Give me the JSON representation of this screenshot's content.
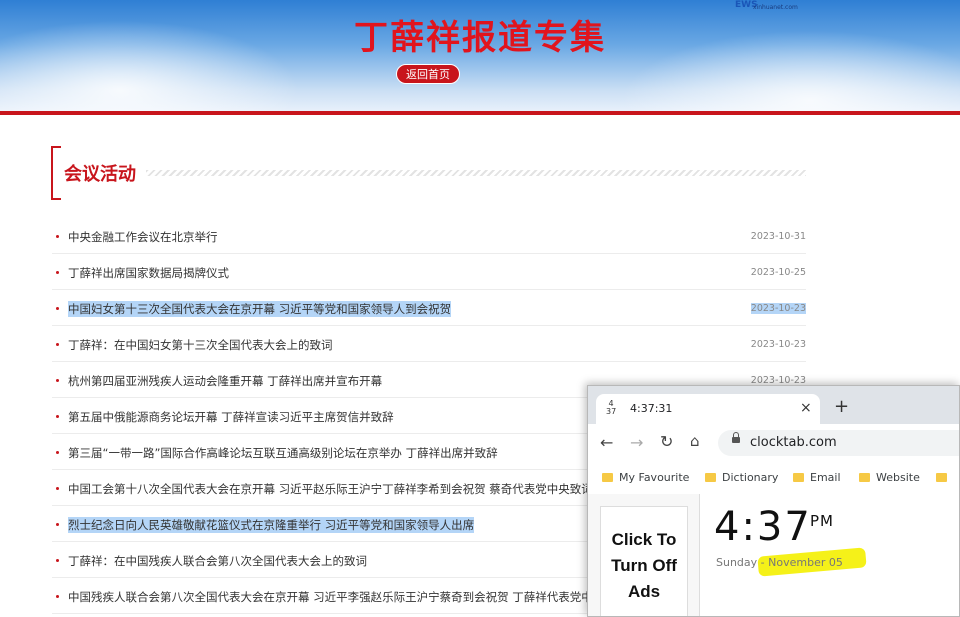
{
  "header": {
    "title": "丁薛祥报道专集",
    "home_label": "返回首页",
    "logo_mark": "EWS",
    "logo_url": "xinhuanet.com"
  },
  "section": {
    "title": "会议活动"
  },
  "news": [
    {
      "title": "中央金融工作会议在北京举行",
      "date": "2023-10-31"
    },
    {
      "title": "丁薛祥出席国家数据局揭牌仪式",
      "date": "2023-10-25"
    },
    {
      "title": "中国妇女第十三次全国代表大会在京开幕 习近平等党和国家领导人到会祝贺",
      "date": "2023-10-23"
    },
    {
      "title": "丁薛祥：在中国妇女第十三次全国代表大会上的致词",
      "date": "2023-10-23"
    },
    {
      "title": "杭州第四届亚洲残疾人运动会隆重开幕 丁薛祥出席并宣布开幕",
      "date": "2023-10-23"
    },
    {
      "title": "第五届中俄能源商务论坛开幕 丁薛祥宣读习近平主席贺信并致辞",
      "date": ""
    },
    {
      "title": "第三届“一带一路”国际合作高峰论坛互联互通高级别论坛在京举办 丁薛祥出席并致辞",
      "date": ""
    },
    {
      "title": "中国工会第十八次全国代表大会在京开幕 习近平赵乐际王沪宁丁薛祥李希到会祝贺 蔡奇代表党中央致词",
      "date": ""
    },
    {
      "title": "烈士纪念日向人民英雄敬献花篮仪式在京隆重举行 习近平等党和国家领导人出席",
      "date": ""
    },
    {
      "title": "丁薛祥：在中国残疾人联合会第八次全国代表大会上的致词",
      "date": ""
    },
    {
      "title": "中国残疾人联合会第八次全国代表大会在京开幕 习近平李强赵乐际王沪宁蔡奇到会祝贺 丁薛祥代表党中央致词",
      "date": ""
    }
  ],
  "browser": {
    "tab_favicon_top": "4",
    "tab_favicon_bottom": "37",
    "tab_title": "4:37:31",
    "tab_close": "×",
    "new_tab": "+",
    "url": "clocktab.com",
    "bookmarks": [
      "My Favourite",
      "Dictionary",
      "Email",
      "Website"
    ],
    "ad_text": [
      "Click To",
      "Turn Off",
      "Ads"
    ],
    "clock_time": "4:37",
    "clock_ampm": "PM",
    "clock_day": "Sunday",
    "clock_sep": "-",
    "clock_date": "November 05"
  }
}
